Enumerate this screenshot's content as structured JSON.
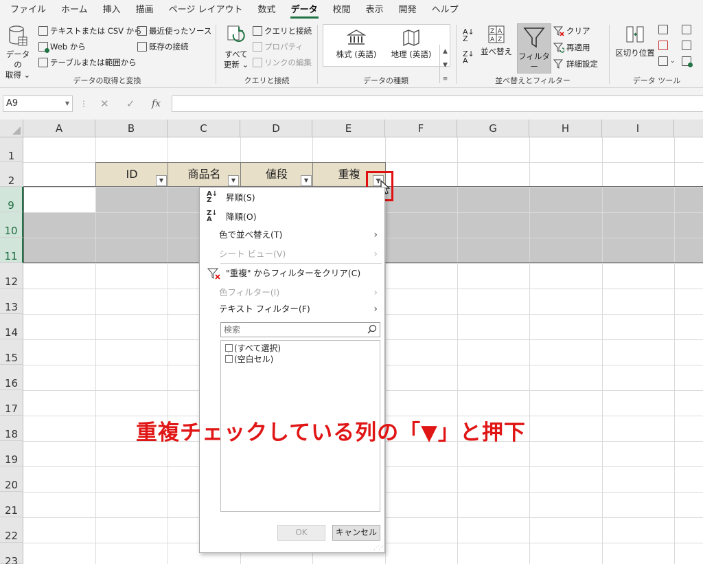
{
  "menu": {
    "tabs": [
      "ファイル",
      "ホーム",
      "挿入",
      "描画",
      "ページ レイアウト",
      "数式",
      "データ",
      "校閲",
      "表示",
      "開発",
      "ヘルプ"
    ],
    "active_tab": "データ"
  },
  "ribbon": {
    "get_data": {
      "big_label_1": "データの",
      "big_label_2": "取得 ⌄",
      "from_text_csv": "テキストまたは CSV から",
      "from_web": "Web から",
      "from_table": "テーブルまたは範囲から",
      "recent_sources": "最近使ったソース",
      "existing_connections": "既存の接続",
      "group_label": "データの取得と変換"
    },
    "queries": {
      "refresh_all_1": "すべて",
      "refresh_all_2": "更新 ⌄",
      "queries_connections": "クエリと接続",
      "properties": "プロパティ",
      "edit_links": "リンクの編集",
      "group_label": "クエリと接続"
    },
    "data_types": {
      "stocks": "株式 (英語)",
      "geography": "地理 (英語)",
      "group_label": "データの種類"
    },
    "sort_filter": {
      "sort": "並べ替え",
      "filter": "フィルター",
      "clear": "クリア",
      "reapply": "再適用",
      "advanced": "詳細設定",
      "group_label": "並べ替えとフィルター"
    },
    "data_tools": {
      "text_to_columns": "区切り位置",
      "group_label": "データ ツール"
    }
  },
  "formula_bar": {
    "name_box": "A9",
    "fx": "fx",
    "cancel": "✕",
    "enter": "✓",
    "formula": ""
  },
  "grid": {
    "columns": [
      "A",
      "B",
      "C",
      "D",
      "E",
      "F",
      "G",
      "H",
      "I"
    ],
    "rows": [
      "1",
      "2",
      "9",
      "10",
      "11",
      "12",
      "13",
      "14",
      "15",
      "16",
      "17",
      "18",
      "19",
      "20",
      "21",
      "22",
      "23"
    ],
    "table_headers": [
      "ID",
      "商品名",
      "値段",
      "重複"
    ]
  },
  "filter_menu": {
    "sort_asc": "昇順(S)",
    "sort_desc": "降順(O)",
    "sort_by_color": "色で並べ替え(T)",
    "sheet_view": "シート ビュー(V)",
    "clear_filter": "\"重複\" からフィルターをクリア(C)",
    "color_filter": "色フィルター(I)",
    "text_filter": "テキスト フィルター(F)",
    "search_placeholder": "検索",
    "list_items": [
      "(すべて選択)",
      "(空白セル)"
    ],
    "ok": "OK",
    "cancel": "キャンセル"
  },
  "annotation": "重複チェックしている列の「▼」と押下"
}
